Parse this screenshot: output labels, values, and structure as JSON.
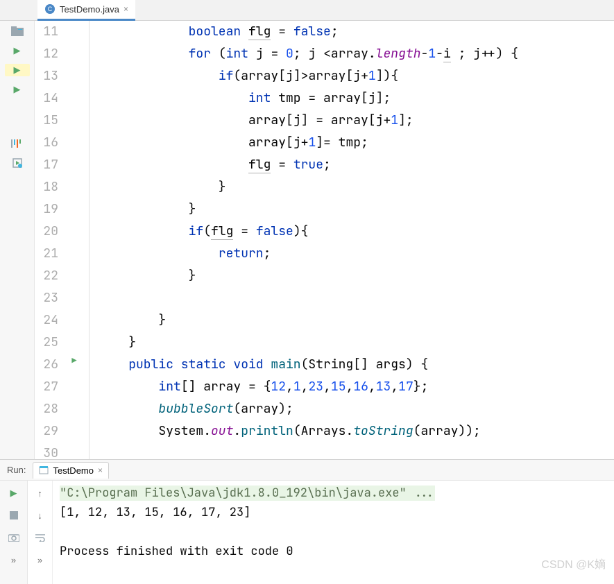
{
  "tab": {
    "filename": "TestDemo.java"
  },
  "gutter": {
    "start": 11,
    "end": 30,
    "play_marker_line": 26
  },
  "code": {
    "lines": [
      [
        [
          "kw",
          "            boolean "
        ],
        [
          "varu",
          "flg"
        ],
        [
          "op",
          " = "
        ],
        [
          "kw",
          "false"
        ],
        [
          "op",
          ";"
        ]
      ],
      [
        [
          "kw",
          "            for "
        ],
        [
          "op",
          "("
        ],
        [
          "kw",
          "int "
        ],
        [
          "var",
          "j"
        ],
        [
          "op",
          " = "
        ],
        [
          "num",
          "0"
        ],
        [
          "op",
          "; "
        ],
        [
          "var",
          "j"
        ],
        [
          "op",
          " <"
        ],
        [
          "var",
          "array"
        ],
        [
          "op",
          "."
        ],
        [
          "field",
          "length"
        ],
        [
          "op",
          "-"
        ],
        [
          "num",
          "1"
        ],
        [
          "op",
          "-"
        ],
        [
          "varu",
          "i"
        ],
        [
          "op",
          " ; "
        ],
        [
          "var",
          "j"
        ],
        [
          "op",
          "++) {"
        ]
      ],
      [
        [
          "txt",
          "                "
        ],
        [
          "kw",
          "if"
        ],
        [
          "op",
          "("
        ],
        [
          "var",
          "array"
        ],
        [
          "op",
          "["
        ],
        [
          "var",
          "j"
        ],
        [
          "op",
          "]>"
        ],
        [
          "var",
          "array"
        ],
        [
          "op",
          "["
        ],
        [
          "var",
          "j"
        ],
        [
          "op",
          "+"
        ],
        [
          "num",
          "1"
        ],
        [
          "op",
          "]){"
        ]
      ],
      [
        [
          "txt",
          "                    "
        ],
        [
          "kw",
          "int "
        ],
        [
          "var",
          "tmp"
        ],
        [
          "op",
          " = "
        ],
        [
          "var",
          "array"
        ],
        [
          "op",
          "["
        ],
        [
          "var",
          "j"
        ],
        [
          "op",
          "];"
        ]
      ],
      [
        [
          "txt",
          "                    "
        ],
        [
          "var",
          "array"
        ],
        [
          "op",
          "["
        ],
        [
          "var",
          "j"
        ],
        [
          "op",
          "] = "
        ],
        [
          "var",
          "array"
        ],
        [
          "op",
          "["
        ],
        [
          "var",
          "j"
        ],
        [
          "op",
          "+"
        ],
        [
          "num",
          "1"
        ],
        [
          "op",
          "];"
        ]
      ],
      [
        [
          "txt",
          "                    "
        ],
        [
          "var",
          "array"
        ],
        [
          "op",
          "["
        ],
        [
          "var",
          "j"
        ],
        [
          "op",
          "+"
        ],
        [
          "num",
          "1"
        ],
        [
          "op",
          "]= "
        ],
        [
          "var",
          "tmp"
        ],
        [
          "op",
          ";"
        ]
      ],
      [
        [
          "txt",
          "                    "
        ],
        [
          "varu",
          "flg"
        ],
        [
          "op",
          " = "
        ],
        [
          "kw",
          "true"
        ],
        [
          "op",
          ";"
        ]
      ],
      [
        [
          "txt",
          "                }"
        ]
      ],
      [
        [
          "txt",
          "            }"
        ]
      ],
      [
        [
          "txt",
          "            "
        ],
        [
          "kw",
          "if"
        ],
        [
          "op",
          "("
        ],
        [
          "varu",
          "flg"
        ],
        [
          "op",
          " = "
        ],
        [
          "kw",
          "false"
        ],
        [
          "op",
          "){"
        ]
      ],
      [
        [
          "txt",
          "                "
        ],
        [
          "kw",
          "return"
        ],
        [
          "op",
          ";"
        ]
      ],
      [
        [
          "txt",
          "            }"
        ]
      ],
      [
        [
          "txt",
          ""
        ]
      ],
      [
        [
          "txt",
          "        }"
        ]
      ],
      [
        [
          "txt",
          "    }"
        ]
      ],
      [
        [
          "txt",
          "    "
        ],
        [
          "kw",
          "public static "
        ],
        [
          "type",
          "void "
        ],
        [
          "fn",
          "main"
        ],
        [
          "op",
          "("
        ],
        [
          "txt",
          "String[] args"
        ],
        [
          "op",
          ") {"
        ]
      ],
      [
        [
          "txt",
          "        "
        ],
        [
          "kw",
          "int"
        ],
        [
          "op",
          "[] "
        ],
        [
          "var",
          "array"
        ],
        [
          "op",
          " = {"
        ],
        [
          "num",
          "12"
        ],
        [
          "op",
          ","
        ],
        [
          "num",
          "1"
        ],
        [
          "op",
          ","
        ],
        [
          "num",
          "23"
        ],
        [
          "op",
          ","
        ],
        [
          "num",
          "15"
        ],
        [
          "op",
          ","
        ],
        [
          "num",
          "16"
        ],
        [
          "op",
          ","
        ],
        [
          "num",
          "13"
        ],
        [
          "op",
          ","
        ],
        [
          "num",
          "17"
        ],
        [
          "op",
          "};"
        ]
      ],
      [
        [
          "txt",
          "        "
        ],
        [
          "fni",
          "bubbleSort"
        ],
        [
          "op",
          "("
        ],
        [
          "var",
          "array"
        ],
        [
          "op",
          ");"
        ]
      ],
      [
        [
          "txt",
          "        System."
        ],
        [
          "field",
          "out"
        ],
        [
          "op",
          "."
        ],
        [
          "fn",
          "println"
        ],
        [
          "op",
          "(Arrays."
        ],
        [
          "fni",
          "toString"
        ],
        [
          "op",
          "("
        ],
        [
          "var",
          "array"
        ],
        [
          "op",
          "));"
        ]
      ],
      [
        [
          "txt",
          ""
        ]
      ]
    ]
  },
  "run": {
    "panel_label": "Run:",
    "config_name": "TestDemo",
    "cmd": "\"C:\\Program Files\\Java\\jdk1.8.0_192\\bin\\java.exe\" ...",
    "output": "[1, 12, 13, 15, 16, 17, 23]",
    "exit": "Process finished with exit code 0"
  },
  "watermark": "CSDN @K嫡"
}
